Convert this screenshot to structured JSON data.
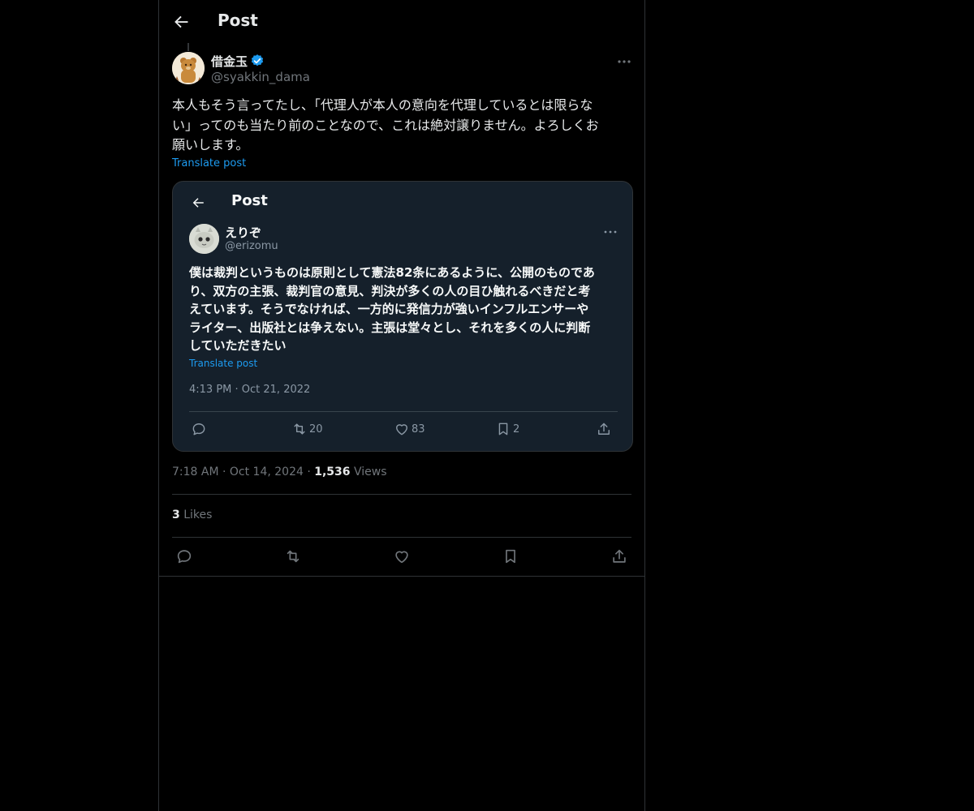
{
  "header": {
    "title": "Post"
  },
  "post": {
    "author_name": "借金玉",
    "author_handle": "@syakkin_dama",
    "text": "本人もそう言ってたし、「代理人が本人の意向を代理しているとは限らな\nい」ってのも当たり前のことなので、これは絶対譲りません。よろしくお\n願いします。",
    "translate_label": "Translate post",
    "timestamp": "7:18 AM · Oct 14, 2024 · ",
    "views_count": "1,536",
    "views_label": " Views",
    "likes_count": "3",
    "likes_label": " Likes"
  },
  "embedded_screenshot": {
    "title": "Post",
    "author_name": "えりぞ",
    "author_handle": "@erizomu",
    "text": "僕は裁判というものは原則として憲法82条にあるように、公開のものであ\nり、双方の主張、裁判官の意見、判決が多くの人の目ひ触れるべきだと考\nえています。そうでなければ、一方的に発信力が強いインフルエンサーや\nライター、出版社とは争えない。主張は堂々とし、それを多くの人に判断\nしていただきたい",
    "translate_label": "Translate post",
    "date": "4:13 PM · Oct 21, 2022",
    "retweets": "20",
    "likes": "83",
    "bookmarks": "2"
  },
  "icons": {
    "back": "arrow-left-icon",
    "verified": "verified-badge-icon",
    "more": "more-icon",
    "reply": "reply-icon",
    "repost": "repost-icon",
    "like": "heart-icon",
    "bookmark": "bookmark-icon",
    "share": "share-icon"
  },
  "colors": {
    "accent": "#1d9bf0",
    "background": "#000000",
    "secondary_text": "#71767b"
  }
}
